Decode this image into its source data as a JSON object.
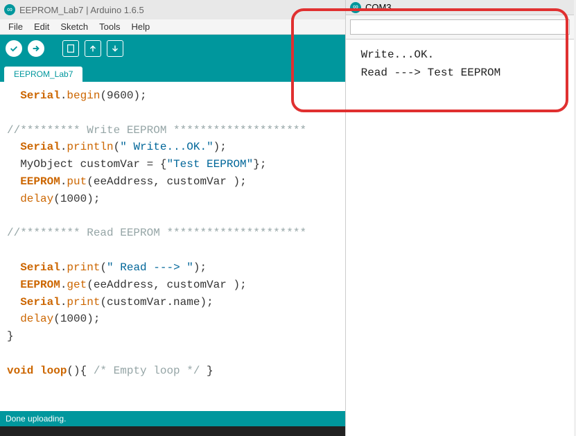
{
  "window": {
    "title": "EEPROM_Lab7 | Arduino 1.6.5"
  },
  "menu": {
    "file": "File",
    "edit": "Edit",
    "sketch": "Sketch",
    "tools": "Tools",
    "help": "Help"
  },
  "tab": {
    "name": "EEPROM_Lab7"
  },
  "code": {
    "l1a": "Serial",
    "l1b": ".",
    "l1c": "begin",
    "l1d": "(9600);",
    "l2": "",
    "l3": "//********* Write EEPROM ********************",
    "l4a": "Serial",
    "l4b": ".",
    "l4c": "println",
    "l4d": "(",
    "l4e": "\" Write...OK.\"",
    "l4f": ");",
    "l5a": "  MyObject customVar = {",
    "l5b": "\"Test EEPROM\"",
    "l5c": "};",
    "l6a": "EEPROM",
    "l6b": ".",
    "l6c": "put",
    "l6d": "(eeAddress, customVar );",
    "l7a": "delay",
    "l7b": "(1000);",
    "l8": "",
    "l9": "//********* Read EEPROM *********************",
    "l10": "",
    "l11a": "Serial",
    "l11b": ".",
    "l11c": "print",
    "l11d": "(",
    "l11e": "\" Read ---> \"",
    "l11f": ");",
    "l12a": "EEPROM",
    "l12b": ".",
    "l12c": "get",
    "l12d": "(eeAddress, customVar );",
    "l13a": "Serial",
    "l13b": ".",
    "l13c": "print",
    "l13d": "(customVar.name);",
    "l14a": "delay",
    "l14b": "(1000);",
    "l15": "}",
    "l16": "",
    "l17a": "void",
    "l17b": " ",
    "l17c": "loop",
    "l17d": "(){ ",
    "l17e": "/* Empty loop */",
    "l17f": " }"
  },
  "status": {
    "text": "Done uploading."
  },
  "serial": {
    "title": "COM3",
    "input_value": "",
    "out1": " Write...OK.",
    "out2": " Read ---> Test EEPROM"
  }
}
